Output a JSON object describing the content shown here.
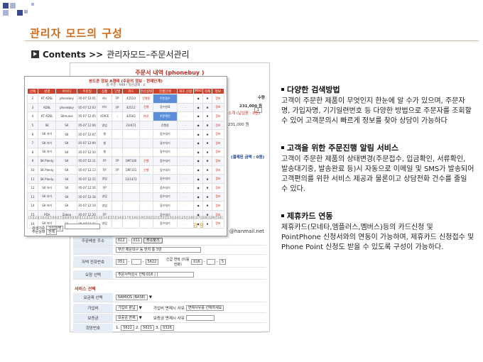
{
  "slide": {
    "title": "관리자 모드의 구성",
    "contents_label": "Contents >>",
    "breadcrumb": "관리자모드–주문서관리"
  },
  "back_form": {
    "title": "주문서 내역 (phonebuy )",
    "price_text": "231,000 원",
    "price_text2": "231,000 원",
    "qty_label": "수량",
    "qty_value": "1",
    "points_text": "소계 (납입중 : 0원)",
    "total_text": "(결제된 금액 : 0원)",
    "email_text": "@hanmail.net",
    "zip_label": "주문배송 주소",
    "zip1": "612",
    "zip2": "011",
    "zip_button": "주소찾기",
    "address": "부산 해운대구 동 번지 통 5반",
    "phone_label": "자택 전화번호",
    "phone1": "051",
    "phone2": "5622",
    "mobile_label": "긴급 연락 (이동전화)",
    "mobile1": "016",
    "mobile2": "5",
    "memo_label": "요청 선택",
    "memo_value": "주문서작성시 선택:016 | |",
    "service_section": "서비스 선택",
    "service_label": "요금제 선택",
    "service_value": "NAMIOS (BASE)",
    "join_label": "가입비",
    "join_value": "가입비 분납",
    "join_note_label": "가입비 면제시 사유",
    "join_note_value": "면제사유를 선택하세요",
    "deposit_label": "보증금",
    "deposit_value": "보증금 면제",
    "deposit_note_label": "보증금 면제시 사유",
    "hope_label": "희망번호",
    "hope1": "5622",
    "hope2": "5621",
    "hope3": "0326"
  },
  "front_list": {
    "header": "본드폰 정보 A형태 (주문의 정보 · 현재단계)",
    "subheader": "총 주문 : 999 / 정산금액 : 0",
    "columns": [
      "선택",
      "성명",
      "아이디",
      "주문일",
      "상품",
      "단말",
      "카드",
      "전산상태",
      "진행단계",
      "최초 신청",
      "MSG",
      "삭제",
      "정보"
    ],
    "rows": [
      [
        "2",
        "KT ADSL",
        "phoneboy",
        "05-07 12:01",
        "카드",
        "FP",
        "42510",
        "진행중",
        "주문접수",
        "·",
        "◆",
        "✖",
        "정보"
      ],
      [
        "3",
        "ADSL",
        "phoneboy",
        "05-07 12:03",
        "카드",
        "FP",
        "42512",
        "진행",
        "접수완료",
        "·",
        "◆",
        "✖",
        "정보"
      ],
      [
        "4",
        "KT ADSL",
        "Stimulus",
        "05-07 12:05",
        "VOICE",
        "-",
        "42502",
        "완료",
        "주문확인",
        "·",
        "◆",
        "✖",
        "정보"
      ],
      [
        "5",
        "SK",
        "SK",
        "05-07 12:06",
        "영업",
        "",
        "23/472",
        "·",
        "진행중",
        "·",
        "◆",
        "✖",
        "정보"
      ],
      [
        "6",
        "SK 아이",
        "SK",
        "05-07 12:07",
        "셀",
        "",
        "",
        "",
        "접수대기",
        "·",
        "◆",
        "✖",
        "정보"
      ],
      [
        "7",
        "SK 아이",
        "SK",
        "05-07 12:09",
        "셀",
        "",
        "",
        "",
        "접수대기",
        "·",
        "◆",
        "✖",
        "정보"
      ],
      [
        "8",
        "SK 아이",
        "SK",
        "05-07 12:10",
        "셀",
        "",
        "",
        "",
        "접수대기",
        "·",
        "◆",
        "✖",
        "정보"
      ],
      [
        "9",
        "SK Plenty",
        "SK",
        "05-07 12:11",
        "FP",
        "FP",
        "1MF100",
        "진행",
        "접수대기",
        "·",
        "◆",
        "✖",
        "정보"
      ],
      [
        "10",
        "SK Plenty",
        "SK",
        "05-07 12:13",
        "FP",
        "FP",
        "1MF101",
        "진행",
        "접수대기",
        "·",
        "◆",
        "✖",
        "정보"
      ],
      [
        "11",
        "SK Plenty",
        "SK",
        "05-07 12:15",
        "영업",
        "",
        "13/1472",
        "",
        "접수대기",
        "·",
        "◆",
        "✖",
        "정보"
      ],
      [
        "12",
        "SK 아이",
        "SK",
        "05-07 12:16",
        "FP",
        "",
        "",
        "",
        "접수대기",
        "·",
        "◆",
        "✖",
        "정보"
      ],
      [
        "13",
        "SK 아이",
        "SK",
        "05-07 12:18",
        "영업",
        "",
        "",
        "",
        "접수대기",
        "·",
        "◆",
        "✖",
        "정보"
      ],
      [
        "14",
        "SK 아이",
        "SK",
        "05-07 12:19",
        "영업",
        "",
        "",
        "",
        "접수대기",
        "·",
        "◆",
        "✖",
        "정보"
      ],
      [
        "15",
        "PDA",
        "Zoboo",
        "05-07 12:20",
        "FP",
        "",
        "",
        "",
        "접수대기",
        "·",
        "◆",
        "✖",
        "정보"
      ],
      [
        "16",
        "SK 아이",
        "SK",
        "05-07 12:22",
        "영업",
        "",
        "",
        "",
        "접수대기",
        "·",
        "◆",
        "✖",
        "정보"
      ]
    ],
    "pager": "[1][2][3][4][5][6][7][8][9][10][11][12][13][14][15][16][17][18][19][20][21][22][23][24][25][26][27][28][29][30]",
    "search_label": "검색기준",
    "search_value": "가입자명",
    "order_label": "주문상태",
    "order_value": "전체",
    "gold_mark": "검 정"
  },
  "notes": [
    {
      "heading": "다양한 검색방법",
      "body": "고객이 주문한 제품이 무엇인지 한눈에 알 수가 있으며, 주문자 명, 가입자명, 기기일련번호 등 다양한 방법으로 주문자를 조회할 수 있어 고객문의시 빠르게 정보를 찾아 상담이 가능하다"
    },
    {
      "heading": "고객을 위한 주문진행 알림 서비스",
      "body": "고객이 주문한 제품의 상태변경(주문접수, 입금확인, 서류확인, 발송대기중, 발송완료 등)시 자동으로 이메일 및 SMS가 발송되어 고객편의를 위한 서비스 제공과 물론이고 상담전화 건수를 줄일 수 있다."
    },
    {
      "heading": "제휴카드 연동",
      "body": "제휴카드(모네타,엠플러스,멤버스)등의 카드신청 및 PointPhone 신청서와의 연동이 가능하며, 제휴카드 신청접수 및 Phone Point 신청도 받을 수 있도록 구성이 가능하다."
    }
  ],
  "colors": {
    "title": "#d36a18",
    "accent_red": "#c9432e",
    "deco_dark": "#3a4a8c",
    "deco_light": "#aab4d8"
  }
}
